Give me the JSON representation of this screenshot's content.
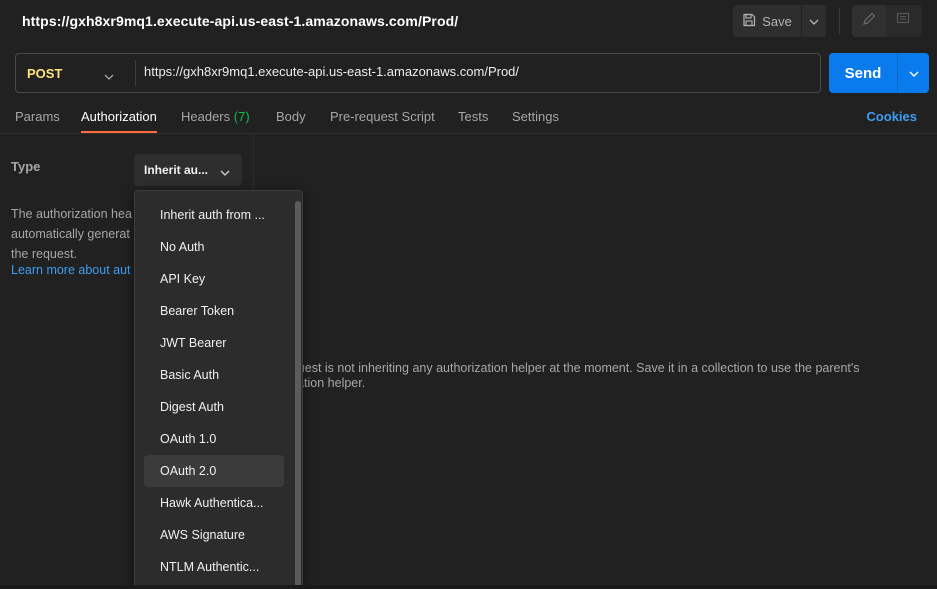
{
  "request": {
    "title": "https://gxh8xr9mq1.execute-api.us-east-1.amazonaws.com/Prod/",
    "method": "POST",
    "url": "https://gxh8xr9mq1.execute-api.us-east-1.amazonaws.com/Prod/"
  },
  "toolbar": {
    "save_label": "Save",
    "send_label": "Send"
  },
  "tabs": {
    "params": "Params",
    "authorization": "Authorization",
    "headers": "Headers",
    "headers_count": "(7)",
    "body": "Body",
    "prerequest": "Pre-request Script",
    "tests": "Tests",
    "settings": "Settings",
    "cookies": "Cookies"
  },
  "auth": {
    "type_label": "Type",
    "selected": "Inherit au...",
    "description": "The authorization hea automatically generat the request.",
    "desc_line1": "The authorization hea",
    "desc_line2": "automatically generat",
    "desc_line3": "the request.",
    "learn_more": "Learn more about aut",
    "inherit_line1": "s request is not inheriting any authorization helper at the moment. Save it in a collection to use the parent's",
    "inherit_line2": "horization helper."
  },
  "dropdown": {
    "items": [
      "Inherit auth from ...",
      "No Auth",
      "API Key",
      "Bearer Token",
      "JWT Bearer",
      "Basic Auth",
      "Digest Auth",
      "OAuth 1.0",
      "OAuth 2.0",
      "Hawk Authentica...",
      "AWS Signature",
      "NTLM Authentic..."
    ],
    "highlighted": "OAuth 2.0"
  },
  "colors": {
    "accent": "#ff6c37",
    "send": "#097bed",
    "method": "#ffe47e",
    "link": "#3f9cf0",
    "badge": "#0cbb52"
  },
  "icons": [
    "save-icon",
    "chevron-down-icon",
    "pencil-icon",
    "comment-icon"
  ]
}
